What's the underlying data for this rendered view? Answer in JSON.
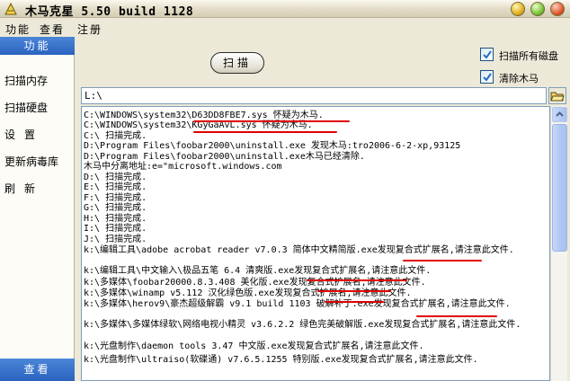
{
  "window": {
    "title": "木马克星 5.50 build 1128",
    "icon": "trojan-star-app-icon"
  },
  "menu": [
    "功能",
    "查看",
    "注册"
  ],
  "sidebar": {
    "header": "功能",
    "items": [
      "扫描内存",
      "扫描硬盘",
      "设置",
      "更新病毒库",
      "刷新"
    ],
    "footer": "查看"
  },
  "controls": {
    "scan_label": "扫描",
    "scan_all_disks": {
      "label": "扫描所有磁盘",
      "checked": true
    },
    "remove_trojans": {
      "label": "清除木马",
      "checked": true
    }
  },
  "path": {
    "value": "L:\\"
  },
  "log": {
    "lines": [
      "C:\\WINDOWS\\system32\\D63DD8FBE7.sys 怀疑为木马.",
      "C:\\WINDOWS\\system32\\KGyGaAvL.sys 怀疑为木马.",
      "C:\\ 扫描完成.",
      "D:\\Program Files\\foobar2000\\uninstall.exe 发现木马:tro2006-6-2-xp,93125",
      "D:\\Program Files\\foobar2000\\uninstall.exe木马已经清除.",
      "木马中分离地址:e=\"microsoft.windows.com",
      "D:\\ 扫描完成.",
      "E:\\ 扫描完成.",
      "F:\\ 扫描完成.",
      "G:\\ 扫描完成.",
      "H:\\ 扫描完成.",
      "I:\\ 扫描完成.",
      "J:\\ 扫描完成.",
      "k:\\编辑工具\\adobe acrobat reader v7.0.3 简体中文精简版.exe发现复合式扩展名,请注意此文件.",
      "k:\\编辑工具\\中文输入\\极品五笔 6.4 清爽版.exe发现复合式扩展名,请注意此文件.",
      "k:\\多媒体\\foobar20000.8.3.408 美化版.exe发现复合式扩展名,请注意此文件.",
      "k:\\多媒体\\winamp v5.112 汉化绿色版.exe发现复合式扩展名,请注意此文件.",
      "k:\\多媒体\\herov9\\豪杰超级解霸 v9.1 build 1103 破解补丁.exe发现复合式扩展名,请注意此文件.",
      "k:\\多媒体\\多媒体绿软\\网络电视小精灵 v3.6.2.2 绿色完美破解版.exe发现复合式扩展名,请注意此文件.",
      "k:\\光盘制作\\daemon tools 3.47 中文版.exe发现复合式扩展名,请注意此文件.",
      "k:\\光盘制作\\ultraiso(软碟通) v7.6.5.1255 特别版.exe发现复合式扩展名,请注意此文件."
    ]
  },
  "icons": {
    "min": "minimize-icon",
    "max": "maximize-icon",
    "close": "close-icon",
    "browse": "folder-open-icon",
    "check": "checkmark-icon"
  },
  "colors": {
    "highlight_underline": "#e00000",
    "sidebar_header": "#2b63bf",
    "check_mark": "#1f6fc4"
  }
}
